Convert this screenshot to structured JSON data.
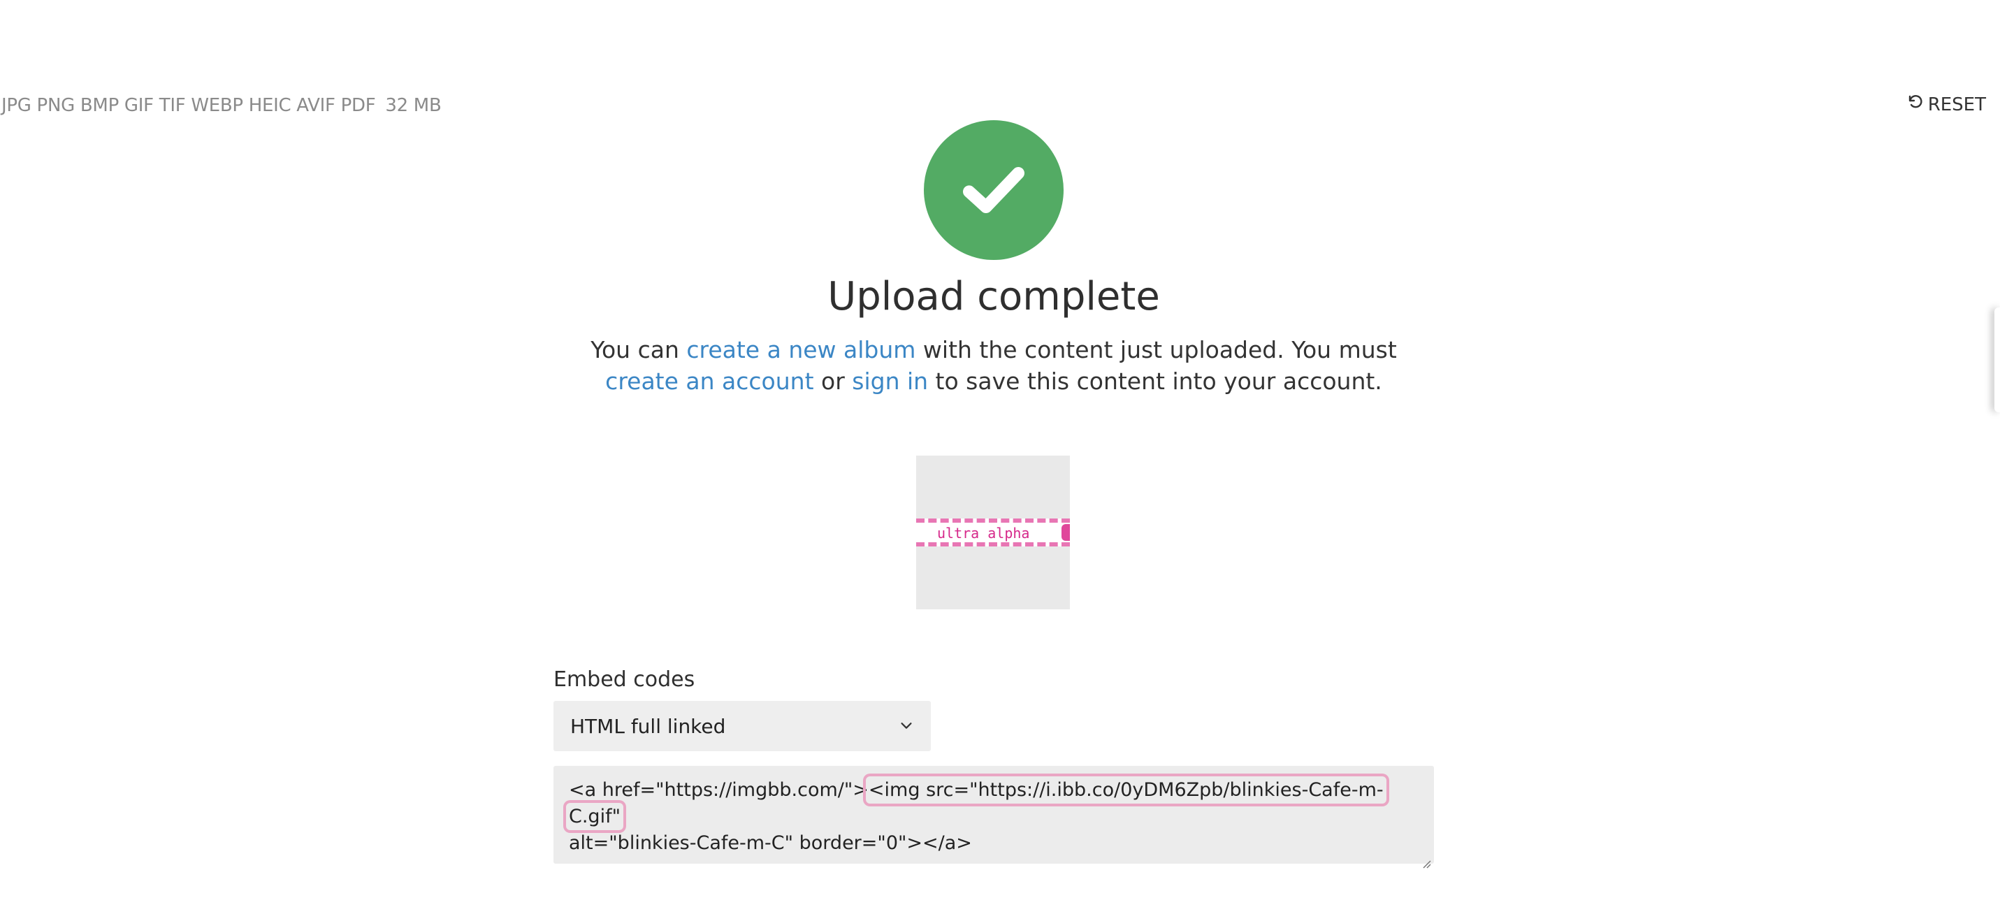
{
  "header": {
    "formats": "JPG PNG BMP GIF TIF WEBP HEIC AVIF PDF",
    "max_size": "32 MB",
    "reset_label": "RESET"
  },
  "status": {
    "icon": "check-icon",
    "color": "#53ab64",
    "title": "Upload complete"
  },
  "message": {
    "part1": "You can ",
    "link_album": "create a new album",
    "part2": " with the content just uploaded. You must ",
    "link_account": "create an account",
    "part3": " or ",
    "link_signin": "sign in",
    "part4": " to save this content into your account.",
    "link_color": "#3b86c5"
  },
  "preview": {
    "banner_text": "ultra alpha"
  },
  "embed": {
    "label": "Embed codes",
    "selected_option": "HTML full linked",
    "code_part1": "<a href=\"https://imgbb.com/\">",
    "code_highlight": "<img src=\"https://i.ibb.co/0yDM6Zpb/blinkies-Cafe-m-C.gif\"",
    "code_part2": "alt=\"blinkies-Cafe-m-C\" border=\"0\"></a>"
  }
}
